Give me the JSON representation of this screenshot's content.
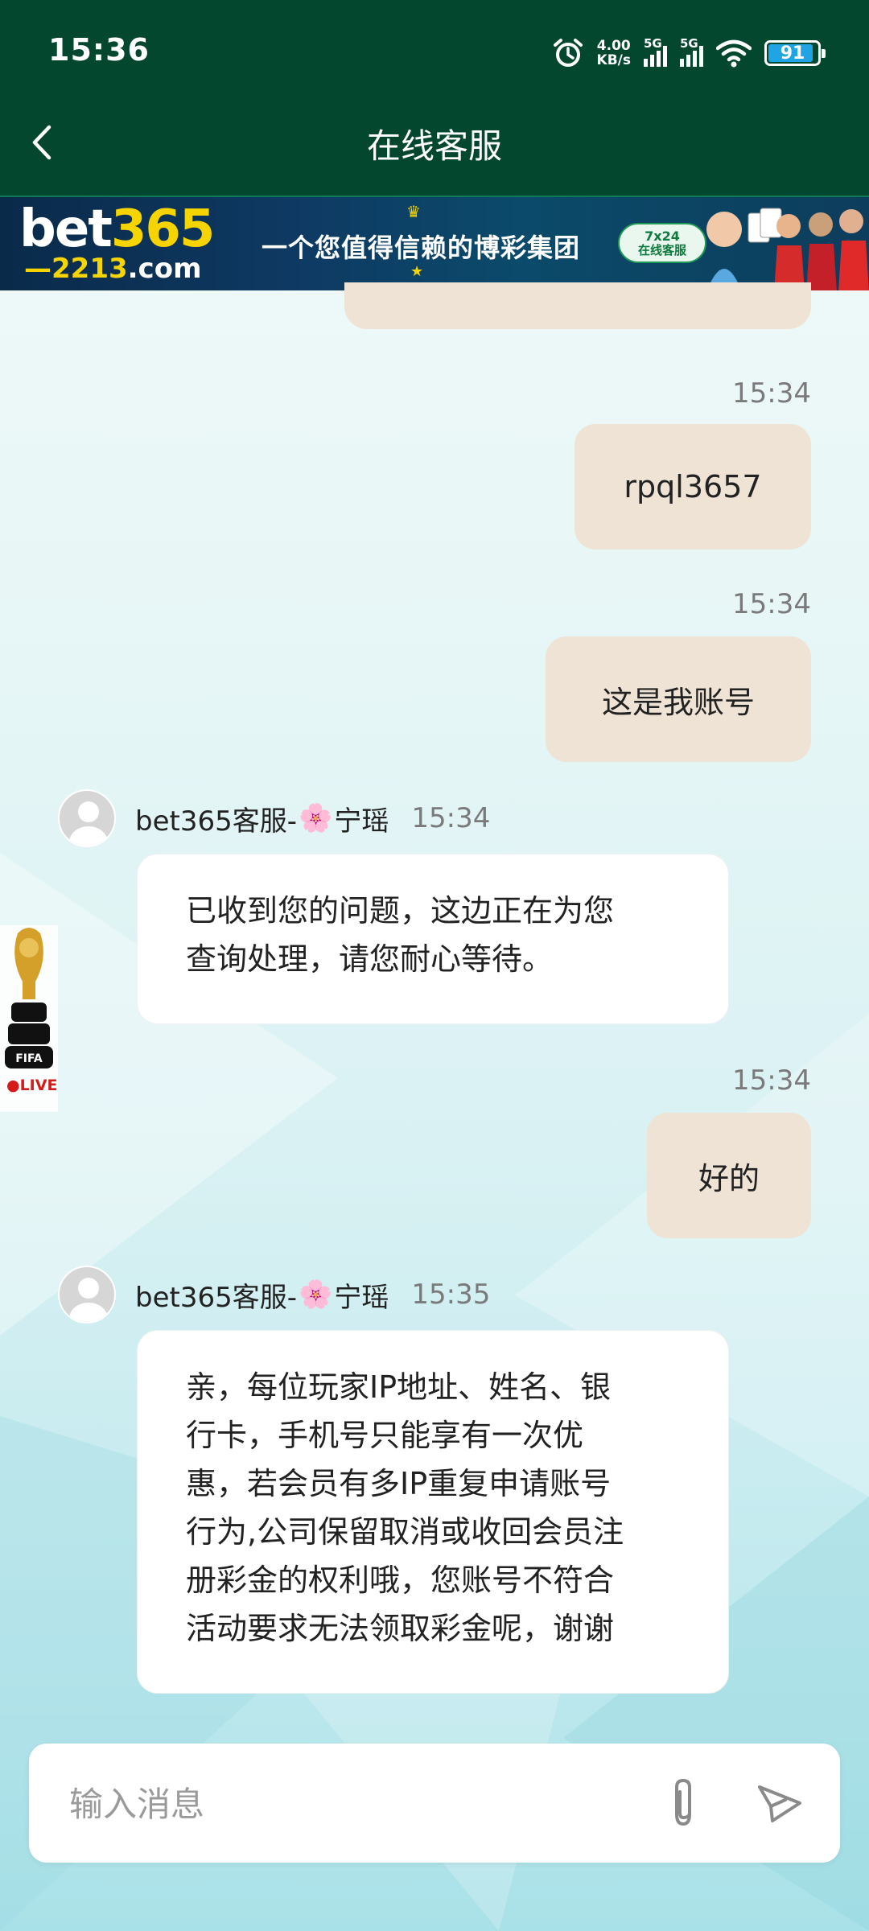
{
  "status_bar": {
    "time": "15:36",
    "net_speed_value": "4.00",
    "net_speed_unit": "KB/s",
    "sim1": "5G",
    "sim2": "5G",
    "battery": "91"
  },
  "header": {
    "title": "在线客服",
    "back_icon": "chevron-left-icon"
  },
  "banner": {
    "logo_main": "bet",
    "logo_num": "365",
    "logo_domain_num": "2213",
    "logo_domain_tld": ".com",
    "slogan": "一个您值得信赖的博彩集团",
    "cs_badge_line1": "7x24",
    "cs_badge_line2": "在线客服"
  },
  "messages": {
    "m1_time": "15:34",
    "m1_text": "rpql3657",
    "m2_time": "15:34",
    "m2_text": "这是我账号",
    "a1_name_prefix": "bet365客服-",
    "a1_flower": "🌸",
    "a1_name_suffix": "宁瑶",
    "a1_time": "15:34",
    "a1_text": "已收到您的问题，这边正在为您\n查询处理，请您耐心等待。",
    "m3_time": "15:34",
    "m3_text": "好的",
    "a2_name_prefix": "bet365客服-",
    "a2_flower": "🌸",
    "a2_name_suffix": "宁瑶",
    "a2_time": "15:35",
    "a2_text": "亲，每位玩家IP地址、姓名、银\n行卡，手机号只能享有一次优\n惠，若会员有多IP重复申请账号\n行为,公司保留取消或收回会员注\n册彩金的权利哦，您账号不符合\n活动要求无法领取彩金呢，谢谢"
  },
  "float_widget": {
    "label": "FIFA",
    "live": "●LIVE"
  },
  "composer": {
    "placeholder": "输入消息",
    "attach_icon": "paperclip-icon",
    "send_icon": "send-icon"
  },
  "colors": {
    "header_bg": "#04472f",
    "outgoing_bubble": "#efe3d6",
    "incoming_bubble": "#ffffff"
  }
}
